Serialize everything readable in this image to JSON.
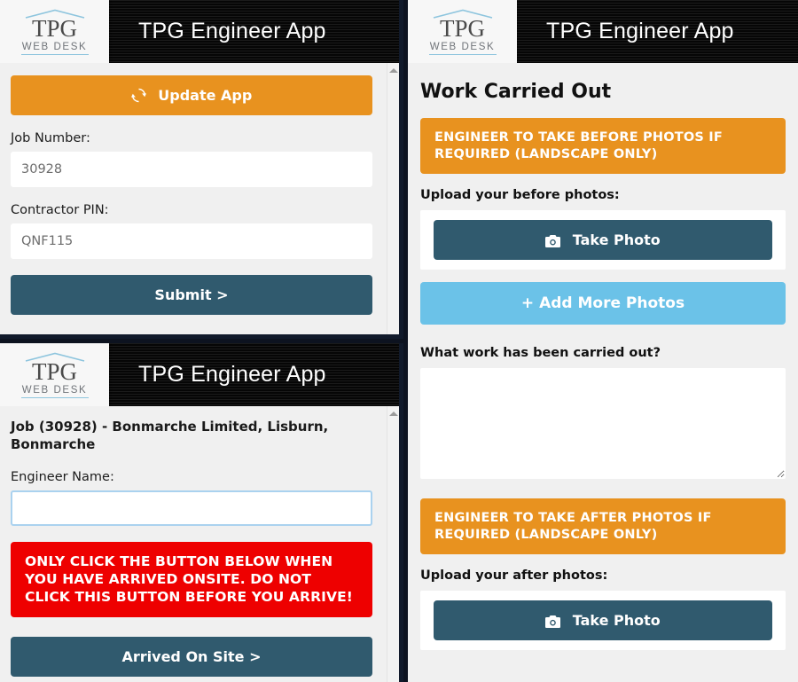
{
  "app": {
    "title": "TPG Engineer App",
    "logo": {
      "primary": "TPG",
      "secondary": "WEB DESK"
    },
    "colors": {
      "orange": "#e8921f",
      "dark_teal": "#305a6e",
      "light_blue": "#6bc2e8",
      "alert_red": "#ee0000",
      "header_black": "#090909",
      "page_grey": "#f0f0f0"
    }
  },
  "panel_login": {
    "update_button": {
      "label": "Update App",
      "icon": "refresh-icon"
    },
    "job_number": {
      "label": "Job Number:",
      "value": "30928",
      "placeholder": "30928"
    },
    "contractor_pin": {
      "label": "Contractor PIN:",
      "value": "QNF115",
      "placeholder": "QNF115"
    },
    "submit_button": {
      "label": "Submit >"
    }
  },
  "panel_job": {
    "job_heading": "Job (30928) - Bonmarche Limited, Lisburn, Bonmarche",
    "engineer_name": {
      "label": "Engineer Name:",
      "value": "",
      "placeholder": ""
    },
    "warning": "ONLY CLICK THE BUTTON BELOW WHEN YOU HAVE ARRIVED ONSITE. DO NOT CLICK THIS BUTTON BEFORE YOU ARRIVE!",
    "arrived_button": {
      "label": "Arrived On Site >"
    }
  },
  "panel_work": {
    "section_title": "Work Carried Out",
    "before_notice": "ENGINEER TO TAKE BEFORE PHOTOS IF REQUIRED (LANDSCAPE ONLY)",
    "before_upload_label": "Upload your before photos:",
    "before_take_photo": {
      "label": "Take Photo",
      "icon": "camera-icon"
    },
    "add_more_photos": {
      "label": "+ Add More Photos"
    },
    "work_question": "What work has been carried out?",
    "work_value": "",
    "work_placeholder": "",
    "after_notice": "ENGINEER TO TAKE AFTER PHOTOS IF REQUIRED (LANDSCAPE ONLY)",
    "after_upload_label": "Upload your after photos:",
    "after_take_photo": {
      "label": "Take Photo",
      "icon": "camera-icon"
    }
  }
}
